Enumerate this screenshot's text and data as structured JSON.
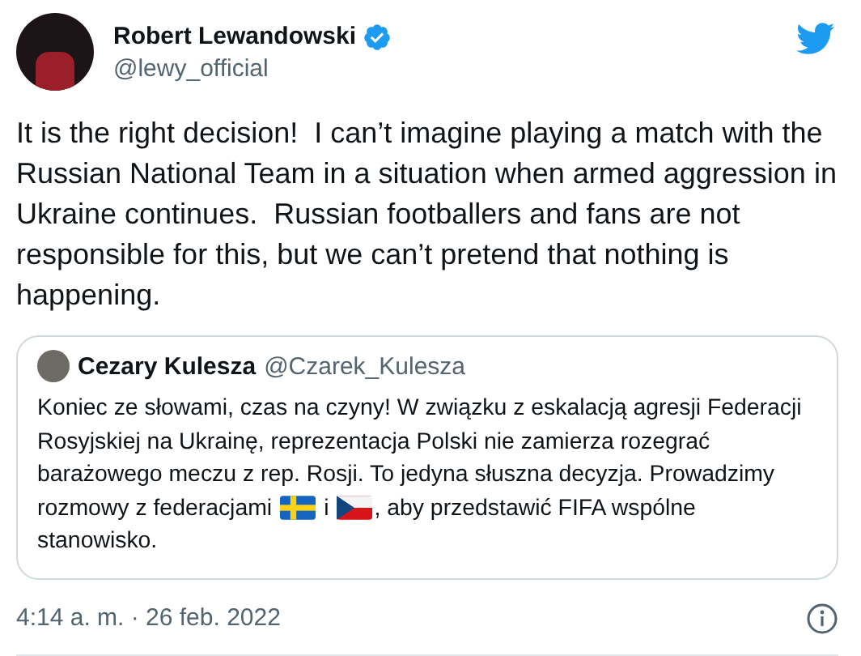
{
  "author": {
    "name": "Robert Lewandowski",
    "verified": true,
    "handle": "@lewy_official"
  },
  "text": "It is the right decision!  I can’t imagine playing a match with the Russian National Team in a situation when armed aggression in Ukraine continues.  Russian footballers and fans are not responsible for this, but we can’t pretend that nothing is happening.",
  "quoted": {
    "name": "Cezary Kulesza",
    "handle": "@Czarek_Kulesza",
    "lines": [
      [
        {
          "kind": "text",
          "text": "Koniec ze słowami, czas na czyny! W związku z eskalacją agresji Federacji"
        }
      ],
      [
        {
          "kind": "text",
          "text": "Rosyjskiej na Ukrainę, reprezentacja Polski nie zamierza rozegrać"
        }
      ],
      [
        {
          "kind": "text",
          "text": "barażowego meczu z rep. Rosji. To jedyna słuszna decyzja. Prowadzimy"
        }
      ],
      [
        {
          "kind": "text",
          "text": "rozmowy z federacjami"
        },
        {
          "kind": "flag-nordic"
        },
        {
          "kind": "text",
          "text": "i"
        },
        {
          "kind": "flag-czech"
        },
        {
          "kind": "text",
          "text": ", aby przedstawić FIFA wspólne"
        }
      ],
      [
        {
          "kind": "text",
          "text": "stanowisko."
        }
      ]
    ]
  },
  "timestamp": "4:14 a. m. · 26 feb. 2022"
}
